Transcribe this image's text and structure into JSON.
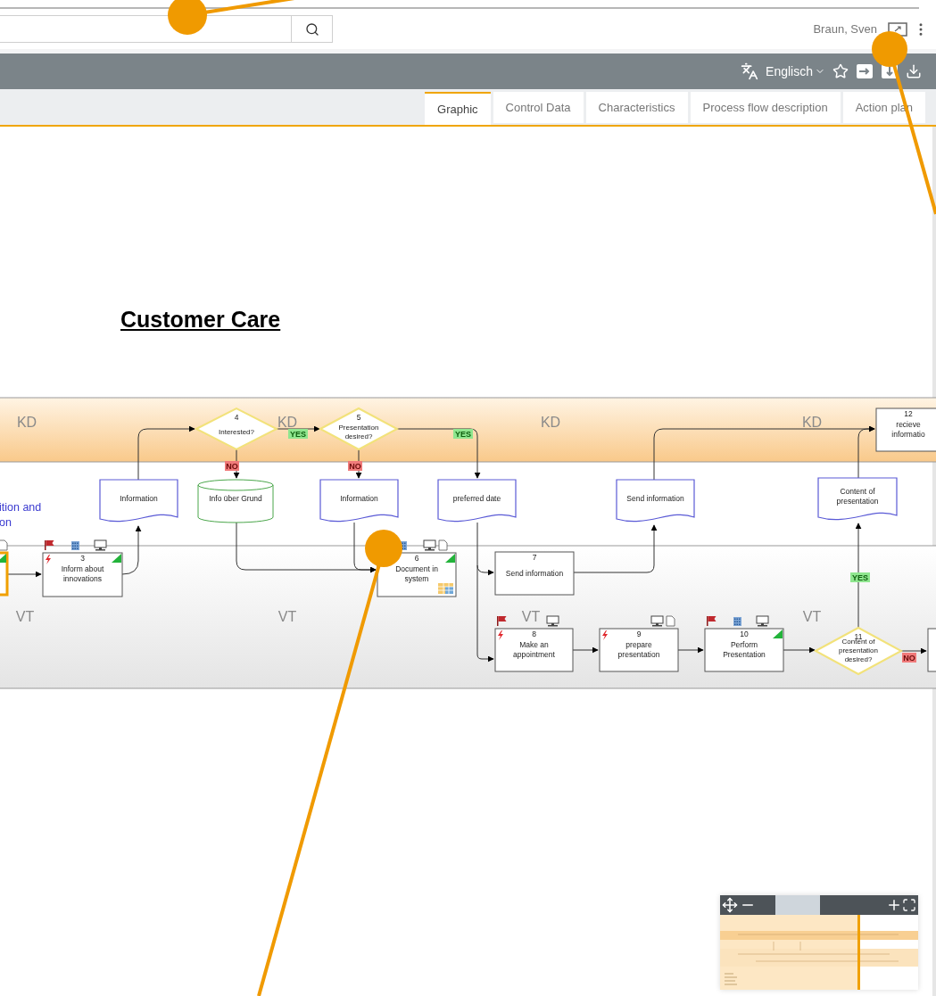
{
  "header": {
    "user": "Braun, Sven"
  },
  "toolbar": {
    "language": "Englisch"
  },
  "tabs": [
    {
      "label": "Graphic",
      "selected": true
    },
    {
      "label": "Control Data",
      "selected": false
    },
    {
      "label": "Characteristics",
      "selected": false
    },
    {
      "label": "Process flow description",
      "selected": false
    },
    {
      "label": "Action plan",
      "selected": false
    }
  ],
  "diagram": {
    "title": "Customer Care",
    "lane_labels": [
      "KD",
      "KD",
      "KD",
      "KD",
      "VT",
      "VT",
      "VT",
      "VT"
    ],
    "side_text": [
      "ition and",
      "on"
    ],
    "processes": [
      {
        "selected": true,
        "markers": [
          {
            "kind": "done"
          },
          {
            "kind": "document"
          }
        ]
      },
      {
        "number": "3",
        "lines": [
          "Inform about",
          "innovations"
        ],
        "selected": false,
        "markers": [
          {
            "kind": "flag"
          },
          {
            "kind": "alert"
          },
          {
            "kind": "done"
          },
          {
            "kind": "org_unit"
          },
          {
            "kind": "it_system"
          }
        ]
      },
      {
        "number": "6",
        "lines": [
          "Document in",
          "system"
        ],
        "selected": false,
        "markers": [
          {
            "kind": "done"
          },
          {
            "kind": "org_unit"
          },
          {
            "kind": "it_system"
          },
          {
            "kind": "document"
          },
          {
            "kind": "attachment"
          }
        ]
      },
      {
        "number": "7",
        "lines": [
          "Send information"
        ],
        "selected": false
      },
      {
        "number": "8",
        "lines": [
          "Make an",
          "appointment"
        ],
        "selected": false,
        "markers": [
          {
            "kind": "flag"
          },
          {
            "kind": "alert"
          },
          {
            "kind": "it_system"
          }
        ]
      },
      {
        "number": "9",
        "lines": [
          "prepare",
          "presentation"
        ],
        "selected": false,
        "markers": [
          {
            "kind": "alert"
          },
          {
            "kind": "it_system"
          },
          {
            "kind": "document"
          }
        ]
      },
      {
        "number": "10",
        "lines": [
          "Perform",
          "Presentation"
        ],
        "selected": false,
        "markers": [
          {
            "kind": "flag"
          },
          {
            "kind": "done"
          },
          {
            "kind": "org_unit"
          },
          {
            "kind": "it_system"
          }
        ]
      },
      {
        "number": "12",
        "lines": [
          "recieve",
          "informatio"
        ],
        "selected": false
      },
      {
        "selected": false
      }
    ],
    "decisions": [
      {
        "number": "4",
        "lines": [
          "Interested?"
        ]
      },
      {
        "number": "5",
        "lines": [
          "Presentation",
          "desired?"
        ]
      },
      {
        "number": "11",
        "lines": [
          "Content of",
          "presentation",
          "desired?"
        ]
      }
    ],
    "data_objects": [
      {
        "kind": "document",
        "lines": [
          "Information"
        ]
      },
      {
        "kind": "database",
        "lines": [
          "Info über Grund"
        ]
      },
      {
        "kind": "document",
        "lines": [
          "Information"
        ]
      },
      {
        "kind": "document",
        "lines": [
          "preferred date"
        ]
      },
      {
        "kind": "document",
        "lines": [
          "Send information"
        ]
      },
      {
        "kind": "document",
        "lines": [
          "Content of",
          "presentation"
        ]
      }
    ],
    "edge_labels": [
      {
        "kind": "yes",
        "text": "YES"
      },
      {
        "kind": "no",
        "text": "NO"
      },
      {
        "kind": "no",
        "text": "NO"
      },
      {
        "kind": "yes",
        "text": "YES"
      },
      {
        "kind": "yes",
        "text": "YES"
      },
      {
        "kind": "no",
        "text": "NO"
      }
    ]
  }
}
